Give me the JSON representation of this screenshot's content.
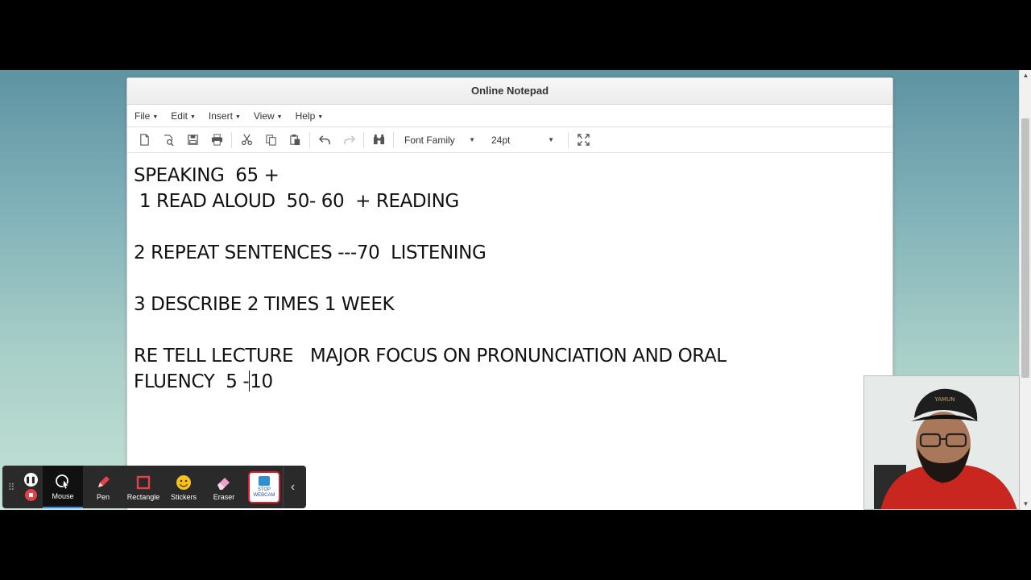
{
  "window": {
    "title": "Online Notepad"
  },
  "menubar": {
    "items": [
      {
        "label": "File"
      },
      {
        "label": "Edit"
      },
      {
        "label": "Insert"
      },
      {
        "label": "View"
      },
      {
        "label": "Help"
      }
    ]
  },
  "toolbar": {
    "buttons": [
      {
        "icon": "new-file-icon"
      },
      {
        "icon": "open-file-icon"
      },
      {
        "icon": "save-icon"
      },
      {
        "icon": "print-icon"
      },
      {
        "icon": "cut-icon"
      },
      {
        "icon": "copy-icon"
      },
      {
        "icon": "paste-icon"
      },
      {
        "icon": "undo-icon"
      },
      {
        "icon": "redo-icon",
        "disabled": true
      },
      {
        "icon": "find-icon"
      },
      {
        "icon": "fullscreen-icon"
      }
    ],
    "font_family": "Font Family",
    "font_size": "24pt"
  },
  "editor": {
    "lines": [
      "SPEAKING  65 +",
      " 1 READ ALOUD  50- 60  + READING",
      "",
      "2 REPEAT SENTENCES ---70  LISTENING",
      "",
      "3 DESCRIBE 2 TIMES 1 WEEK",
      "",
      "RE TELL LECTURE   MAJOR FOCUS ON PRONUNCIATION AND ORAL"
    ],
    "last_line_before_cursor": "FLUENCY  5 -",
    "last_line_after_cursor": "10"
  },
  "recorder": {
    "tools": [
      {
        "label": "Mouse",
        "active": true
      },
      {
        "label": "Pen"
      },
      {
        "label": "Rectangle"
      },
      {
        "label": "Stickers"
      },
      {
        "label": "Eraser"
      }
    ],
    "webcam_label": "STOP WEBCAM",
    "accent": "#2f8cf0",
    "stop_color": "#e8404a"
  },
  "webcam_overlay": {
    "cap_text": "YAMUN"
  }
}
